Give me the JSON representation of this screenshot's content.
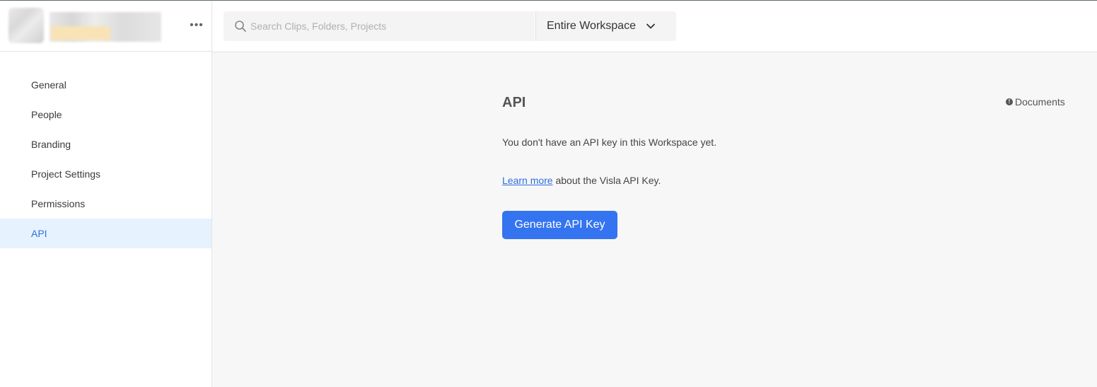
{
  "sidebar": {
    "more_label": "•••",
    "items": [
      {
        "label": "General"
      },
      {
        "label": "People"
      },
      {
        "label": "Branding"
      },
      {
        "label": "Project Settings"
      },
      {
        "label": "Permissions"
      },
      {
        "label": "API",
        "active": true
      }
    ]
  },
  "topbar": {
    "search_placeholder": "Search Clips, Folders, Projects",
    "search_icon": "search-icon",
    "scope_label": "Entire Workspace",
    "scope_icon": "chevron-down-icon"
  },
  "main": {
    "title": "API",
    "docs_label": "Documents",
    "docs_icon": "info-icon",
    "no_key_text": "You don't have an API key in this Workspace yet.",
    "learn_link": "Learn more",
    "learn_suffix": " about the Visla API Key.",
    "generate_button": "Generate API Key"
  },
  "colors": {
    "accent": "#3574f0",
    "active_nav_bg": "#e6f2fd",
    "active_nav_text": "#2f6fe0",
    "main_bg": "#f7f7f7"
  }
}
